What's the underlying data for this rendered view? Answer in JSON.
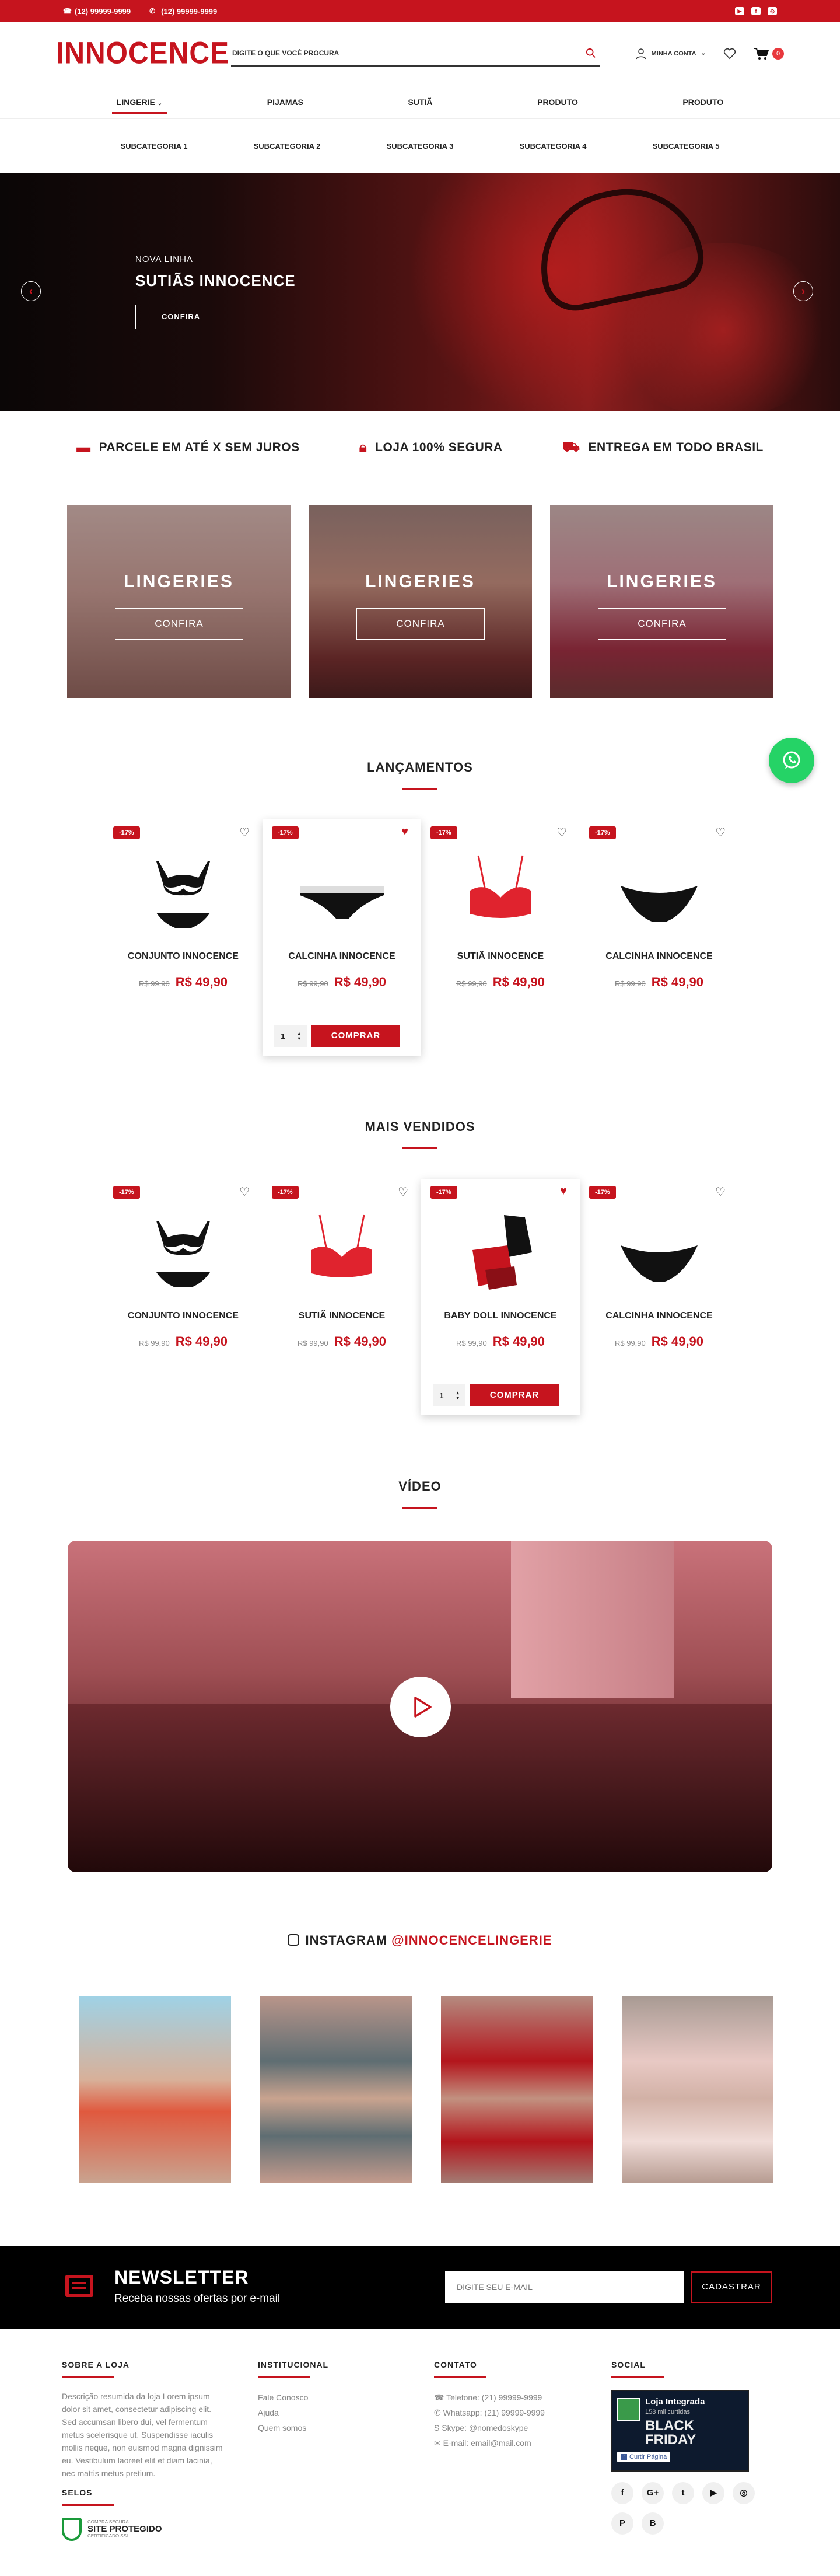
{
  "topbar": {
    "phone1": "(12) 99999-9999",
    "phone2": "(12) 99999-9999"
  },
  "header": {
    "logo": "INNOCENCE",
    "search_placeholder": "DIGITE O QUE VOCÊ PROCURA",
    "account": "MINHA CONTA",
    "cart_count": "0"
  },
  "nav": {
    "items": [
      "LINGERIE",
      "PIJAMAS",
      "SUTIÃ",
      "PRODUTO",
      "PRODUTO"
    ]
  },
  "subnav": {
    "items": [
      "SUBCATEGORIA 1",
      "SUBCATEGORIA 2",
      "SUBCATEGORIA 3",
      "SUBCATEGORIA 4",
      "SUBCATEGORIA 5"
    ]
  },
  "hero": {
    "tag": "NOVA LINHA",
    "title": "SUTIÃS INNOCENCE",
    "cta": "CONFIRA"
  },
  "features": [
    "PARCELE EM ATÉ X SEM JUROS",
    "LOJA 100% SEGURA",
    "ENTREGA EM TODO BRASIL"
  ],
  "categories": [
    {
      "name": "LINGERIES",
      "cta": "CONFIRA"
    },
    {
      "name": "LINGERIES",
      "cta": "CONFIRA"
    },
    {
      "name": "LINGERIES",
      "cta": "CONFIRA"
    }
  ],
  "launches": {
    "title": "LANÇAMENTOS",
    "products": [
      {
        "discount": "-17%",
        "name": "CONJUNTO INNOCENCE",
        "old": "R$ 99,90",
        "price": "R$ 49,90"
      },
      {
        "discount": "-17%",
        "name": "CALCINHA INNOCENCE",
        "old": "R$ 99,90",
        "price": "R$ 49,90",
        "qty": "1",
        "buy": "COMPRAR"
      },
      {
        "discount": "-17%",
        "name": "SUTIÃ INNOCENCE",
        "old": "R$ 99,90",
        "price": "R$ 49,90"
      },
      {
        "discount": "-17%",
        "name": "CALCINHA INNOCENCE",
        "old": "R$ 99,90",
        "price": "R$ 49,90"
      }
    ]
  },
  "bestsellers": {
    "title": "MAIS VENDIDOS",
    "products": [
      {
        "discount": "-17%",
        "name": "CONJUNTO INNOCENCE",
        "old": "R$ 99,90",
        "price": "R$ 49,90"
      },
      {
        "discount": "-17%",
        "name": "SUTIÃ INNOCENCE",
        "old": "R$ 99,90",
        "price": "R$ 49,90"
      },
      {
        "discount": "-17%",
        "name": "BABY DOLL INNOCENCE",
        "old": "R$ 99,90",
        "price": "R$ 49,90",
        "qty": "1",
        "buy": "COMPRAR"
      },
      {
        "discount": "-17%",
        "name": "CALCINHA INNOCENCE",
        "old": "R$ 99,90",
        "price": "R$ 49,90"
      }
    ]
  },
  "video": {
    "title": "VÍDEO"
  },
  "instagram": {
    "prefix": "INSTAGRAM",
    "handle": "@INNOCENCELINGERIE"
  },
  "newsletter": {
    "title": "NEWSLETTER",
    "subtitle": "Receba nossas ofertas por e-mail",
    "placeholder": "DIGITE SEU E-MAIL",
    "button": "CADASTRAR"
  },
  "footer": {
    "about": {
      "title": "SOBRE A LOJA",
      "text": "Descrição resumida da loja Lorem ipsum dolor sit amet, consectetur adipiscing elit. Sed accumsan libero dui, vel fermentum metus scelerisque ut. Suspendisse iaculis mollis neque, non euismod magna dignissim eu. Vestibulum laoreet elit et diam lacinia, nec mattis metus pretium."
    },
    "seals_title": "SELOS",
    "seal": {
      "line1": "COMPRA SEGURA",
      "line2": "SITE PROTEGIDO",
      "line3": "CERTIFICADO SSL"
    },
    "institutional": {
      "title": "INSTITUCIONAL",
      "links": [
        "Fale Conosco",
        "Ajuda",
        "Quem somos"
      ]
    },
    "contact": {
      "title": "CONTATO",
      "items": [
        "Telefone: (21) 99999-9999",
        "Whatsapp: (21) 99999-9999",
        "Skype: @nomedoskype",
        "E-mail: email@mail.com"
      ]
    },
    "social": {
      "title": "SOCIAL",
      "fb_name": "Loja Integrada",
      "fb_likes": "158 mil curtidas",
      "fb_button": "Curtir Página",
      "fb_banner1": "BLACK",
      "fb_banner2": "FRIDAY"
    }
  },
  "colors": {
    "brand": "#c6141e",
    "whatsapp": "#25d366"
  }
}
